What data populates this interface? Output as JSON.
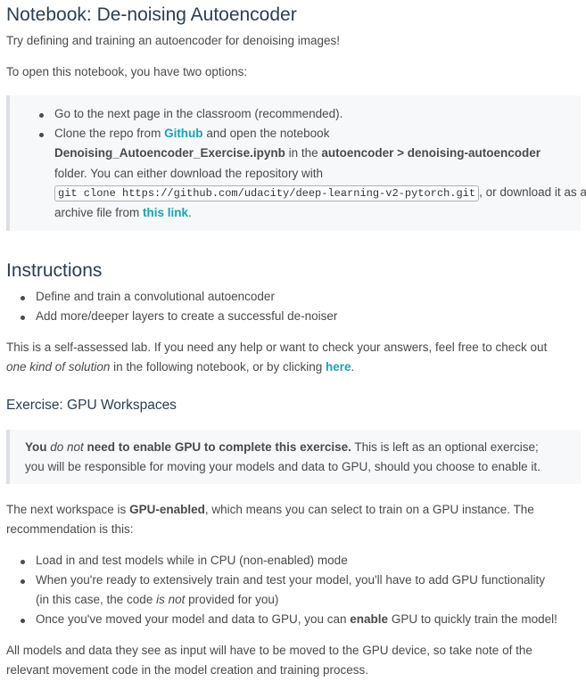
{
  "title": "Notebook: De-noising Autoencoder",
  "intro": "Try defining and training an autoencoder for denoising images!",
  "open_options": "To open this notebook, you have two options:",
  "options": {
    "item1": "Go to the next page in the classroom (recommended).",
    "item2_a": "Clone the repo from ",
    "item2_link": "Github",
    "item2_b": " and open the notebook",
    "item2_notebook": "Denoising_Autoencoder_Exercise.ipynb",
    "item2_c": " in the ",
    "item2_path": "autoencoder > denoising-autoencoder",
    "item2_d": "folder. You can either download the repository with",
    "item2_code": "git clone https://github.com/udacity/deep-learning-v2-pytorch.git",
    "item2_e": ", or download it as an",
    "item2_f": "archive file from ",
    "item2_link2": "this link",
    "item2_g": "."
  },
  "instructions": {
    "heading": "Instructions",
    "items": [
      "Define and train a convolutional autoencoder",
      "Add more/deeper layers to create a successful de-noiser"
    ]
  },
  "self_assessed": {
    "line1": "This is a self-assessed lab. If you need any help or want to check your answers, feel free to check out",
    "line2_em": "one kind of solution",
    "line2_mid": " in the following notebook, or by clicking ",
    "line2_link": "here",
    "line2_end": "."
  },
  "gpu": {
    "heading": "Exercise: GPU Workspaces",
    "quote_b1": "You ",
    "quote_em": "do not",
    "quote_b2": " need to enable GPU to complete this exercise.",
    "quote_rest1": " This is left as an optional exercise;",
    "quote_line2": "you will be responsible for moving your models and data to GPU, should you choose to enable it.",
    "next_a": "The next workspace is ",
    "next_b": "GPU-enabled",
    "next_c": ", which means you can select to train on a GPU instance. The",
    "next_line2": "recommendation is this:",
    "rec1": "Load in and test models while in CPU (non-enabled) mode",
    "rec2_line1": "When you're ready to extensively train and test your model, you'll have to add GPU functionality",
    "rec2_line2_a": "(in this case, the code ",
    "rec2_line2_em": "is not",
    "rec2_line2_b": " provided for you)",
    "rec3_a": "Once you've moved your model and data to GPU, you can ",
    "rec3_b": "enable",
    "rec3_c": " GPU to quickly train the model!",
    "final_line1": "All models and data they see as input will have to be moved to the GPU device, so take note of the",
    "final_line2": "relevant movement code in the model creation and training process."
  }
}
